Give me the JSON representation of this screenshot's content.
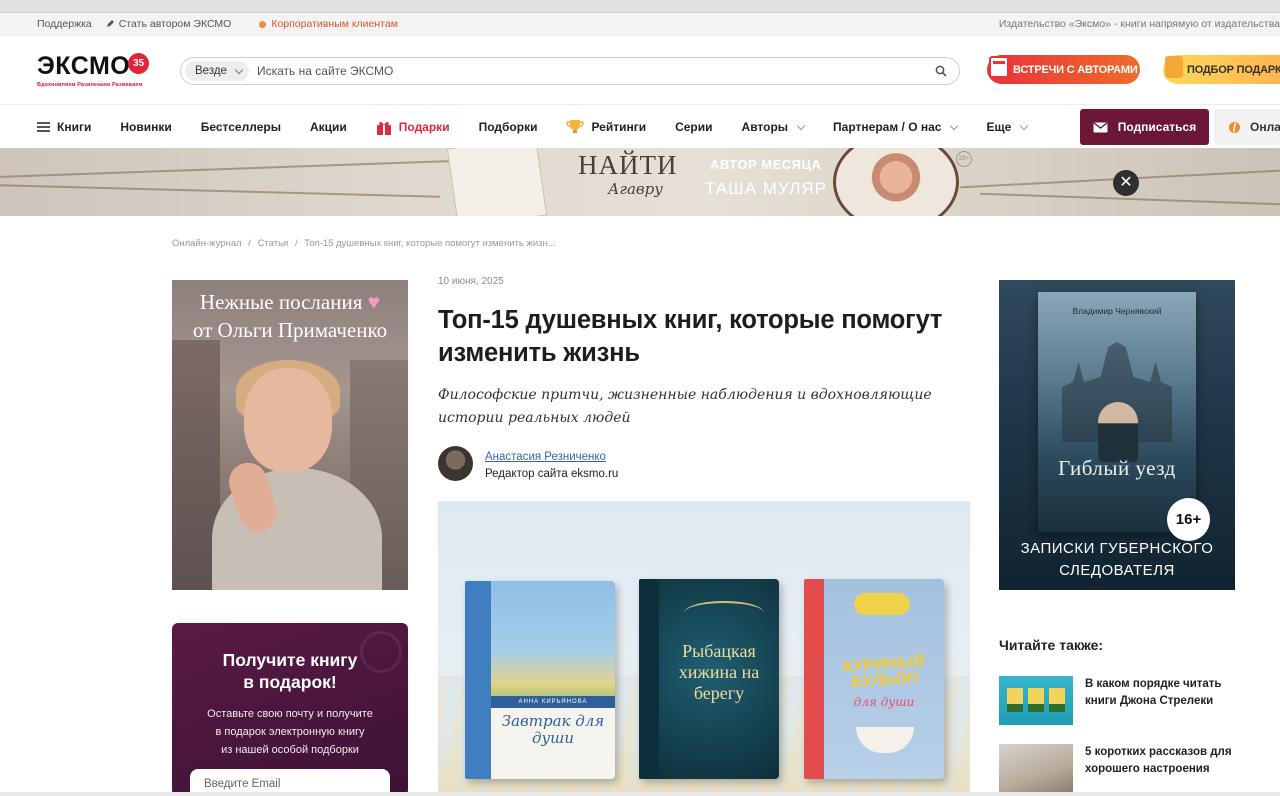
{
  "utility": {
    "support": "Поддержка",
    "become_author": "Стать автором ЭКСМО",
    "corporate": "Корпоративным клиентам",
    "tagline": "Издательство «Эксмо» - книги напрямую от издательства"
  },
  "header": {
    "logo_text": "ЭКСМО",
    "logo_badge": "35",
    "logo_tagline": "Вдохновляем Развлекаем Развиваем",
    "search_scope": "Везде",
    "search_placeholder": "Искать на сайте ЭКСМО",
    "promo_meetings": "ВСТРЕЧИ С АВТОРАМИ",
    "promo_gifts": "ПОДБОР ПОДАРКА"
  },
  "nav": {
    "items": [
      {
        "label": "Книги"
      },
      {
        "label": "Новинки"
      },
      {
        "label": "Бестселлеры"
      },
      {
        "label": "Акции"
      },
      {
        "label": "Подарки"
      },
      {
        "label": "Подборки"
      },
      {
        "label": "Рейтинги"
      },
      {
        "label": "Серии"
      },
      {
        "label": "Авторы"
      },
      {
        "label": "Партнерам / О нас"
      },
      {
        "label": "Еще"
      }
    ],
    "subscribe": "Подписаться",
    "online": "Онла"
  },
  "banner": {
    "find_line1": "НАЙТИ",
    "find_line2": "Агаврy",
    "author_of_month": "АВТОР МЕСЯЦА",
    "author_name": "ТАША МУЛЯР",
    "age": "18+",
    "close": "✕"
  },
  "breadcrumb": {
    "items": [
      "Онлайн-журнал",
      "Статьи",
      "Топ-15 душевных книг, которые помогут изменить жизн..."
    ],
    "separator": "/"
  },
  "left_ad": {
    "line1": "Нежные послания",
    "line2": "от Ольги Примаченко"
  },
  "gift_card": {
    "title_line1": "Получите книгу",
    "title_line2": "в подарок!",
    "desc_line1": "Оставьте свою почту и получите",
    "desc_line2": "в подарок электронную книгу",
    "desc_line3": "из нашей особой подборки",
    "email_placeholder": "Введите Email"
  },
  "article": {
    "date": "10 июня, 2025",
    "title": "Топ-15 душевных книг, которые помогут изменить жизнь",
    "lead": "Философские притчи, жизненные наблюдения и вдохновляющие истории реальных людей",
    "author_name": "Анастасия Резниченко",
    "author_role": "Редактор сайта eksmo.ru"
  },
  "hero_books": {
    "book1_author": "АННА КИРЬЯНОВА",
    "book1_title": "Завтрак для души",
    "book2_title": "Рыбацкая хижина на берегу",
    "book3_title": "КУРИНЫЙ БУЛЬОН",
    "book3_title2": "для души"
  },
  "right_ad": {
    "book_author": "Владимир Чернявский",
    "book_title": "Гиблый уезд",
    "age": "16+",
    "bottom_line1": "ЗАПИСКИ ГУБЕРНСКОГО",
    "bottom_line2": "СЛЕДОВАТЕЛЯ"
  },
  "read_also": {
    "title": "Читайте также:",
    "items": [
      {
        "text": "В каком порядке читать книги Джона Стрелеки"
      },
      {
        "text": "5 коротких рассказов для хорошего настроения"
      }
    ]
  },
  "colors": {
    "brand_red": "#e2263a",
    "subscribe_bg": "#6d1738",
    "gift_card_bg": "#4a1640",
    "link_blue": "#3a61b3",
    "corporate_orange": "#e0582a"
  }
}
